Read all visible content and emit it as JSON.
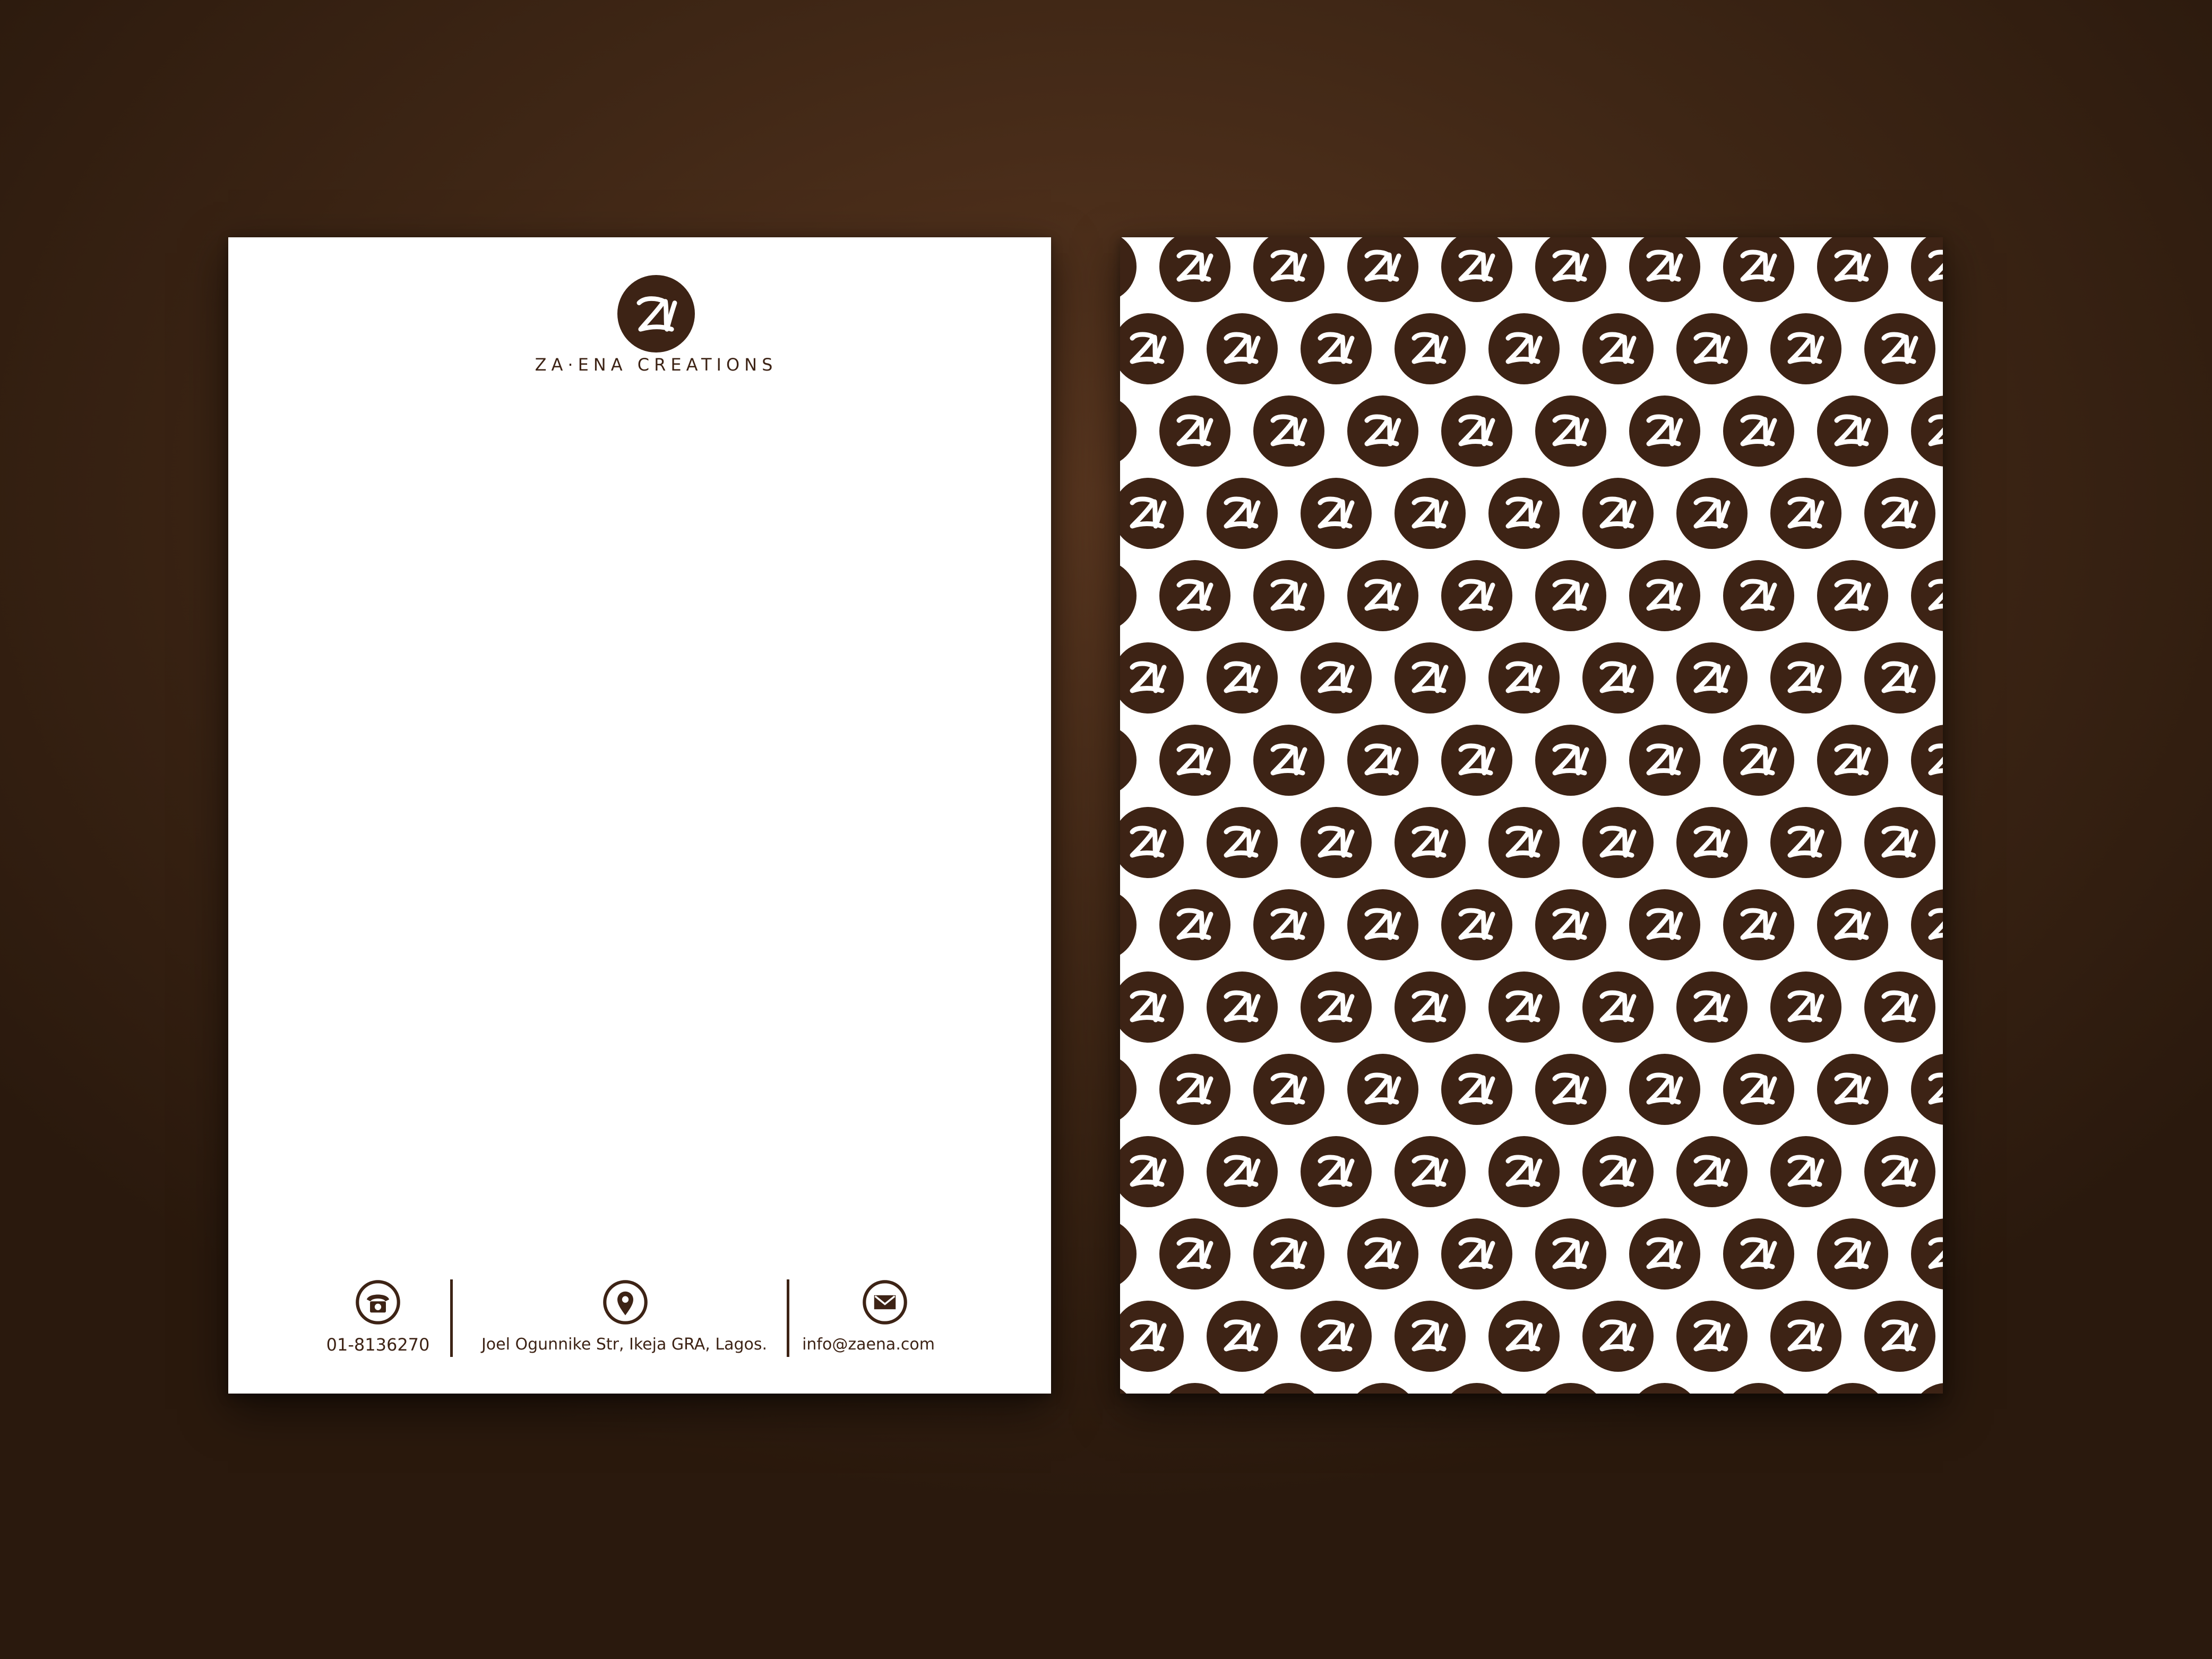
{
  "brand": {
    "name": "ZA·ENA CREATIONS",
    "monogram": "ZI",
    "colors": {
      "primary": "#3d2315",
      "paper": "#ffffff",
      "background": "#4a2e1a"
    }
  },
  "footer": {
    "phone": "01-8136270",
    "address": "Joel Ogunnike Str, Ikeja GRA, Lagos.",
    "email": "info@zaena.com",
    "icons": [
      "phone-icon",
      "location-pin-icon",
      "mail-icon"
    ]
  }
}
